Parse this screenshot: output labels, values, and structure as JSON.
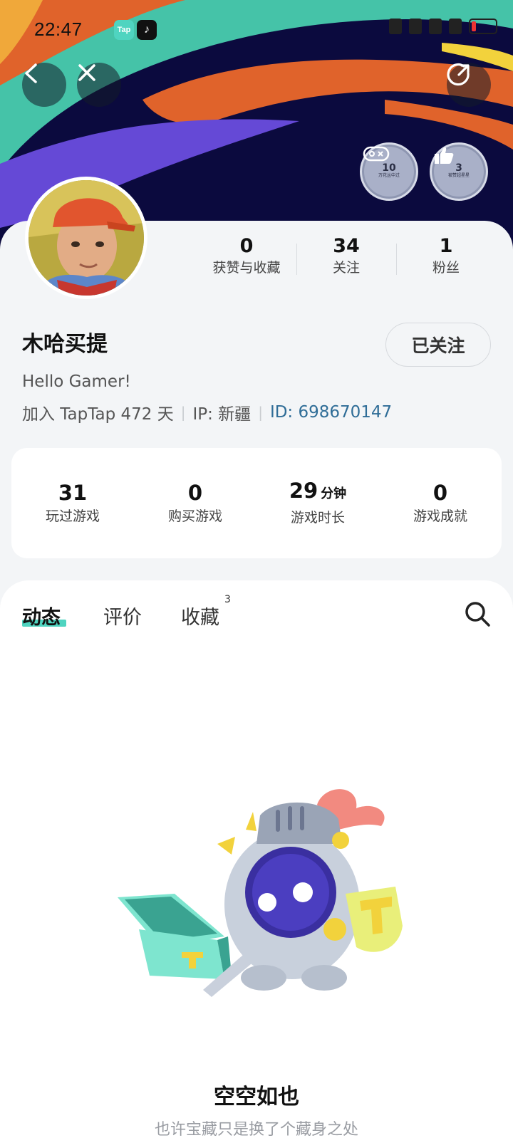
{
  "status_bar": {
    "time": "22:47",
    "apps": [
      "Tap",
      "TikTok"
    ],
    "battery": "10"
  },
  "nav": {
    "back_icon": "chevron-left-icon",
    "close_icon": "close-icon",
    "share_icon": "share-icon"
  },
  "badges": [
    {
      "number": "10",
      "caption": "万花丛中过",
      "icon": "gamepad-icon"
    },
    {
      "number": "3",
      "caption": "被赞超星星",
      "icon": "thumbs-up-icon"
    }
  ],
  "profile": {
    "stats": [
      {
        "value": "0",
        "label": "获赞与收藏"
      },
      {
        "value": "34",
        "label": "关注"
      },
      {
        "value": "1",
        "label": "粉丝"
      }
    ],
    "name": "木哈买提",
    "follow_label": "已关注",
    "bio": "Hello Gamer!",
    "joined": "加入 TapTap 472 天",
    "ip": "IP: 新疆",
    "id": "ID: 698670147"
  },
  "game_stats": [
    {
      "value": "31",
      "unit": "",
      "label": "玩过游戏"
    },
    {
      "value": "0",
      "unit": "",
      "label": "购买游戏"
    },
    {
      "value": "29",
      "unit": "分钟",
      "label": "游戏时长"
    },
    {
      "value": "0",
      "unit": "",
      "label": "游戏成就"
    }
  ],
  "tabs": [
    {
      "label": "动态",
      "active": true
    },
    {
      "label": "评价",
      "active": false
    },
    {
      "label": "收藏",
      "active": false,
      "count": "3"
    }
  ],
  "empty_state": {
    "title": "空空如也",
    "subtitle": "也许宝藏只是换了个藏身之处"
  },
  "colors": {
    "accent": "#4fd4c0",
    "id_link": "#2f6d97",
    "banner_bg": "#0b0a3e"
  }
}
